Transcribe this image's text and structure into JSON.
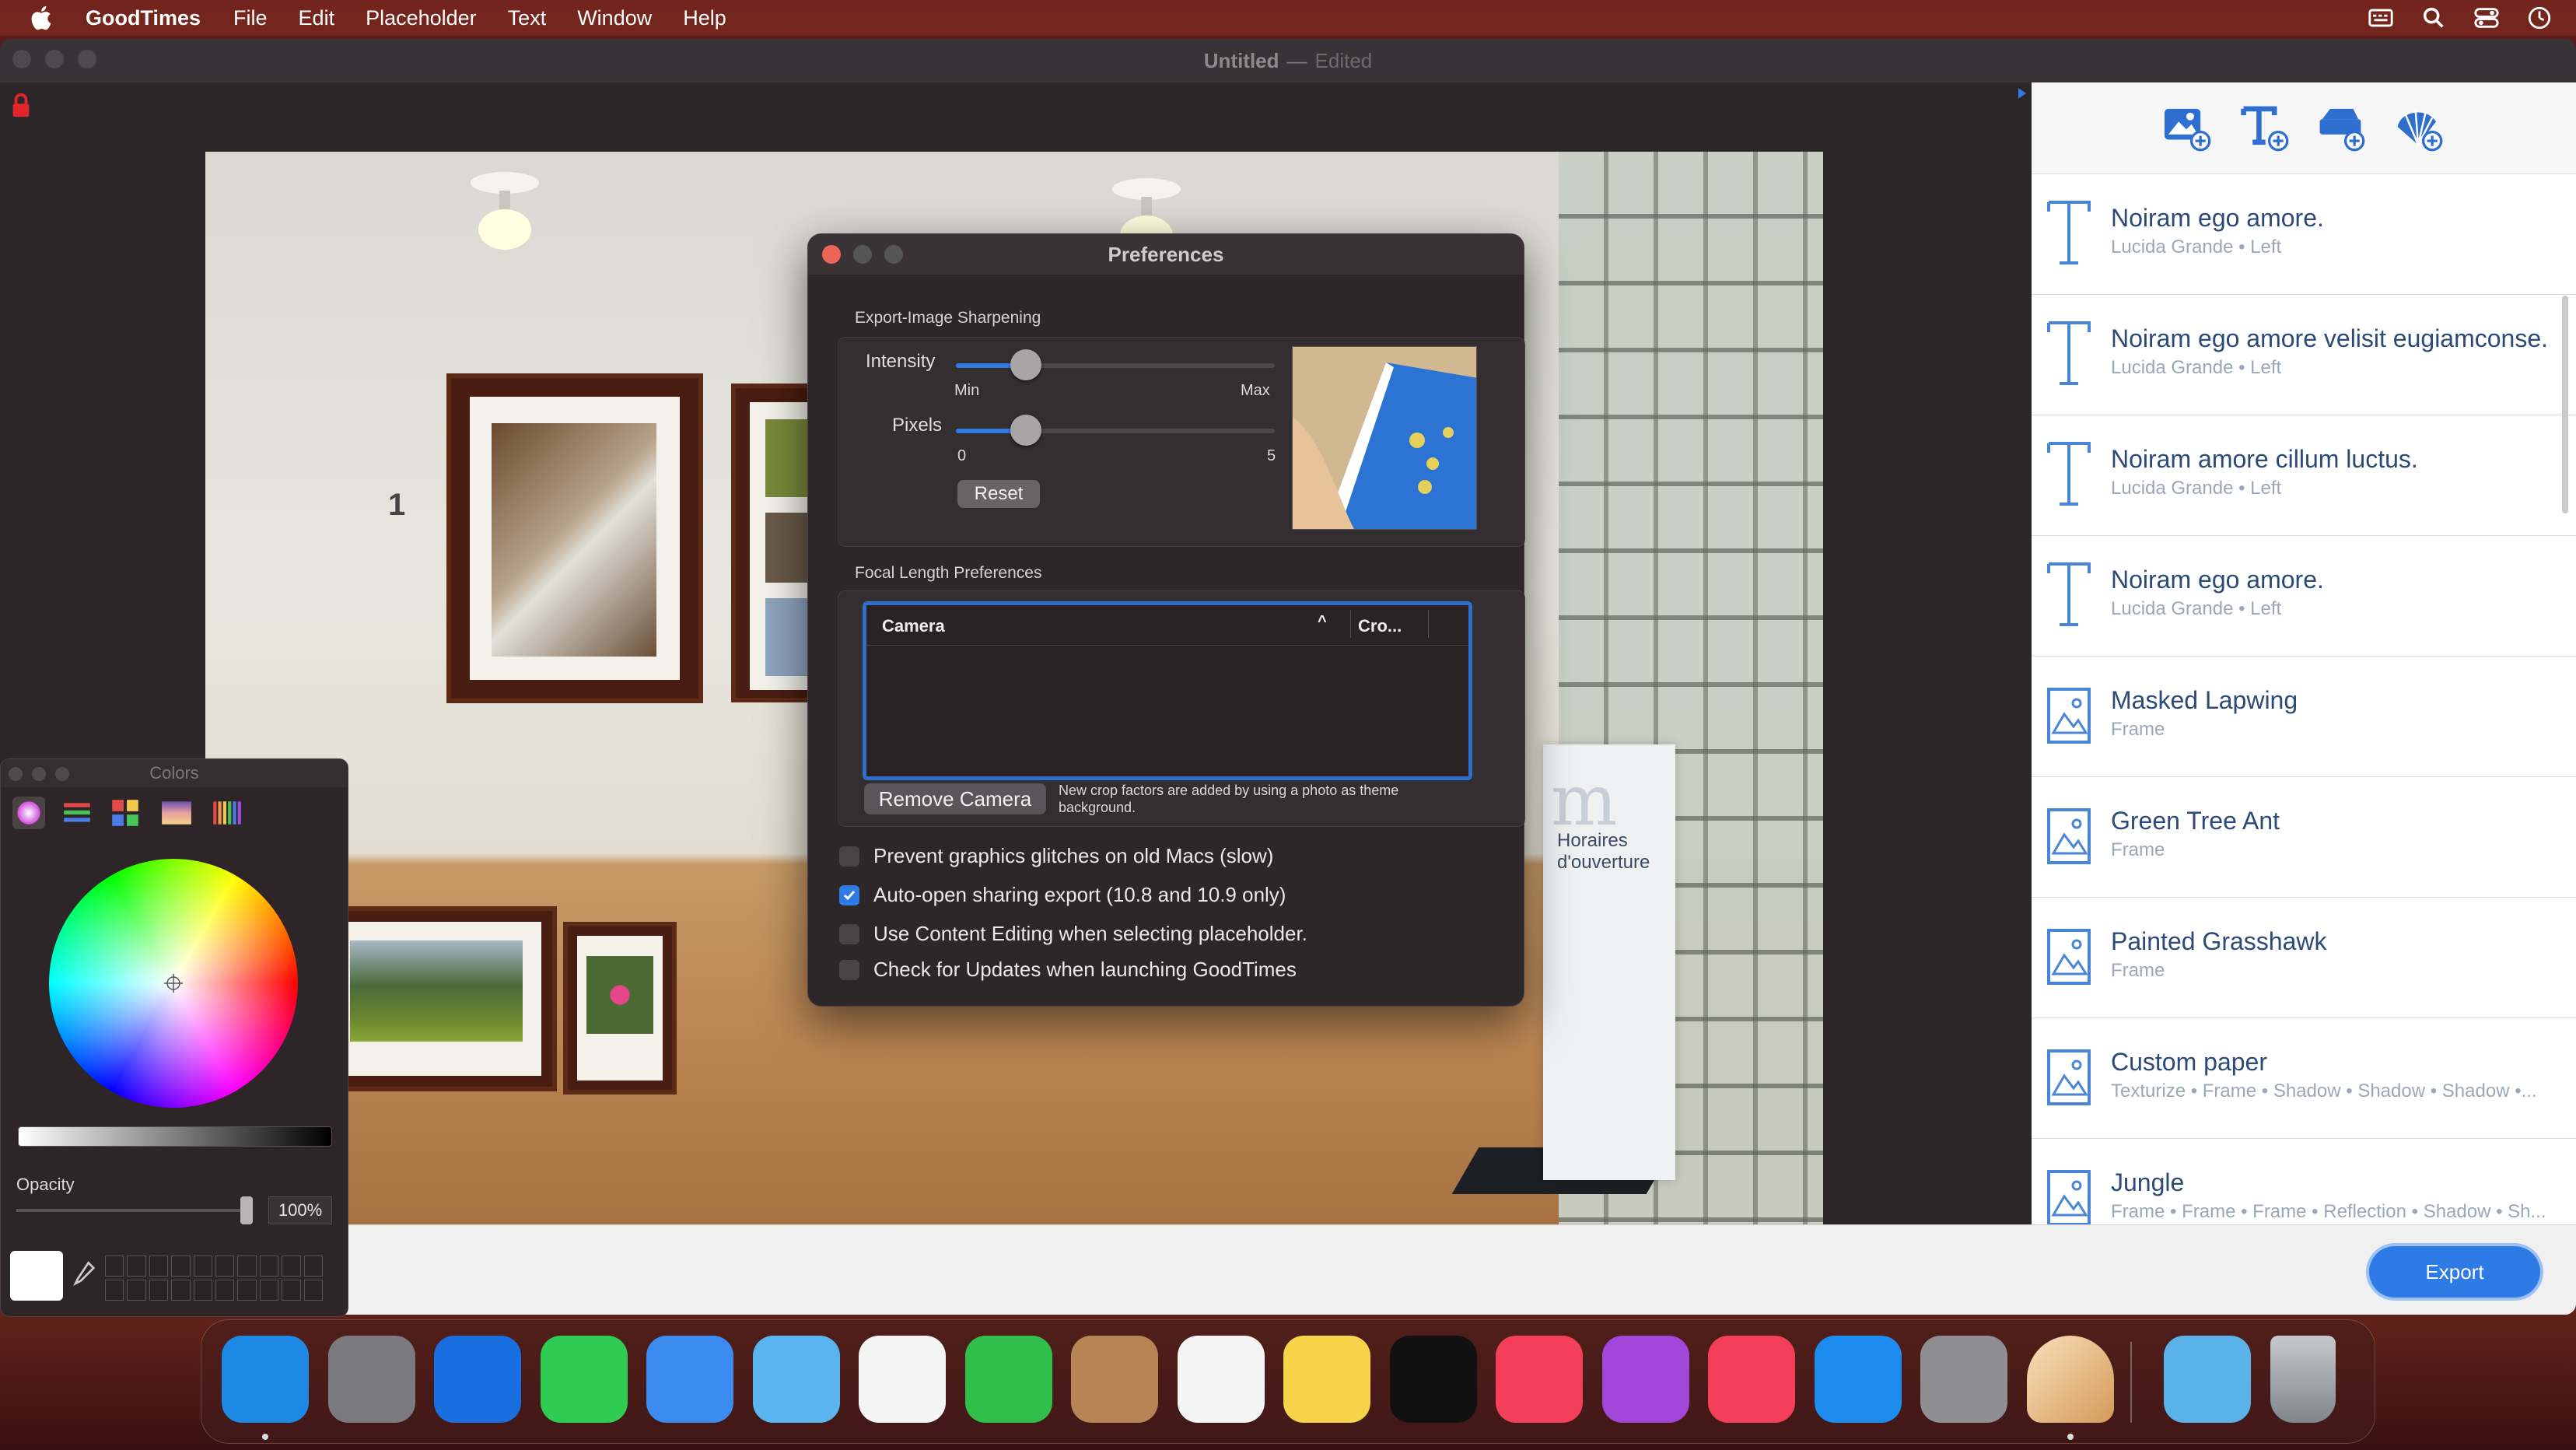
{
  "menubar": {
    "app_name": "GoodTimes",
    "items": [
      "File",
      "Edit",
      "Placeholder",
      "Text",
      "Window",
      "Help"
    ]
  },
  "window": {
    "title": "Untitled",
    "separator": "—",
    "status": "Edited"
  },
  "canvas": {
    "gallery_number": "1",
    "banner_text_line1": "Horaires",
    "banner_text_line2": "d'ouverture"
  },
  "preferences": {
    "title": "Preferences",
    "sharpening_label": "Export-Image Sharpening",
    "intensity_label": "Intensity",
    "intensity_min": "Min",
    "intensity_max": "Max",
    "intensity_value": 0.22,
    "pixels_label": "Pixels",
    "pixels_min": "0",
    "pixels_max": "5",
    "pixels_value": 0.22,
    "reset_label": "Reset",
    "focal_label": "Focal Length Preferences",
    "table_col_camera": "Camera",
    "table_col_crop": "Cro...",
    "remove_camera_label": "Remove Camera",
    "crop_note": "New crop factors are added by using a photo as theme background.",
    "checkboxes": [
      {
        "label": "Prevent graphics glitches on old Macs (slow)",
        "checked": false
      },
      {
        "label": "Auto-open sharing export (10.8 and 10.9 only)",
        "checked": true
      },
      {
        "label": "Use Content Editing when selecting placeholder.",
        "checked": false
      },
      {
        "label": "Check for Updates when launching GoodTimes",
        "checked": false
      }
    ]
  },
  "colors_panel": {
    "title": "Colors",
    "opacity_label": "Opacity",
    "opacity_value": "100%"
  },
  "layers": [
    {
      "name": "Noiram ego amore.",
      "sub": "Lucida Grande • Left",
      "icon": "text-icon"
    },
    {
      "name": "Noiram ego amore velisit eugiamconse.",
      "sub": "Lucida Grande • Left",
      "icon": "text-icon"
    },
    {
      "name": "Noiram amore cillum luctus.",
      "sub": "Lucida Grande • Left",
      "icon": "text-icon"
    },
    {
      "name": "Noiram ego amore.",
      "sub": "Lucida Grande • Left",
      "icon": "text-icon"
    },
    {
      "name": "Masked Lapwing",
      "sub": "Frame",
      "icon": "image-icon"
    },
    {
      "name": "Green Tree Ant",
      "sub": "Frame",
      "icon": "image-icon"
    },
    {
      "name": "Painted Grasshawk",
      "sub": "Frame",
      "icon": "image-icon"
    },
    {
      "name": "Custom paper",
      "sub": "Texturize • Frame • Shadow • Shadow • Shadow •...",
      "icon": "image-icon"
    },
    {
      "name": "Jungle",
      "sub": "Frame • Frame • Frame • Reflection • Shadow • Sh...",
      "icon": "image-icon"
    }
  ],
  "bottom": {
    "export_label": "Export"
  },
  "dock": [
    "Finder",
    "Launchpad",
    "Safari",
    "Messages",
    "Mail",
    "Maps",
    "Photos",
    "FaceTime",
    "Contacts",
    "Reminders",
    "Notes",
    "TV",
    "Music",
    "Podcasts",
    "News",
    "App Store",
    "System Preferences",
    "GoodTimes",
    "Downloads",
    "Trash"
  ],
  "colors": {
    "accent": "#2f7be6",
    "close": "#ec6559",
    "layer_text": "#2b4a78"
  }
}
